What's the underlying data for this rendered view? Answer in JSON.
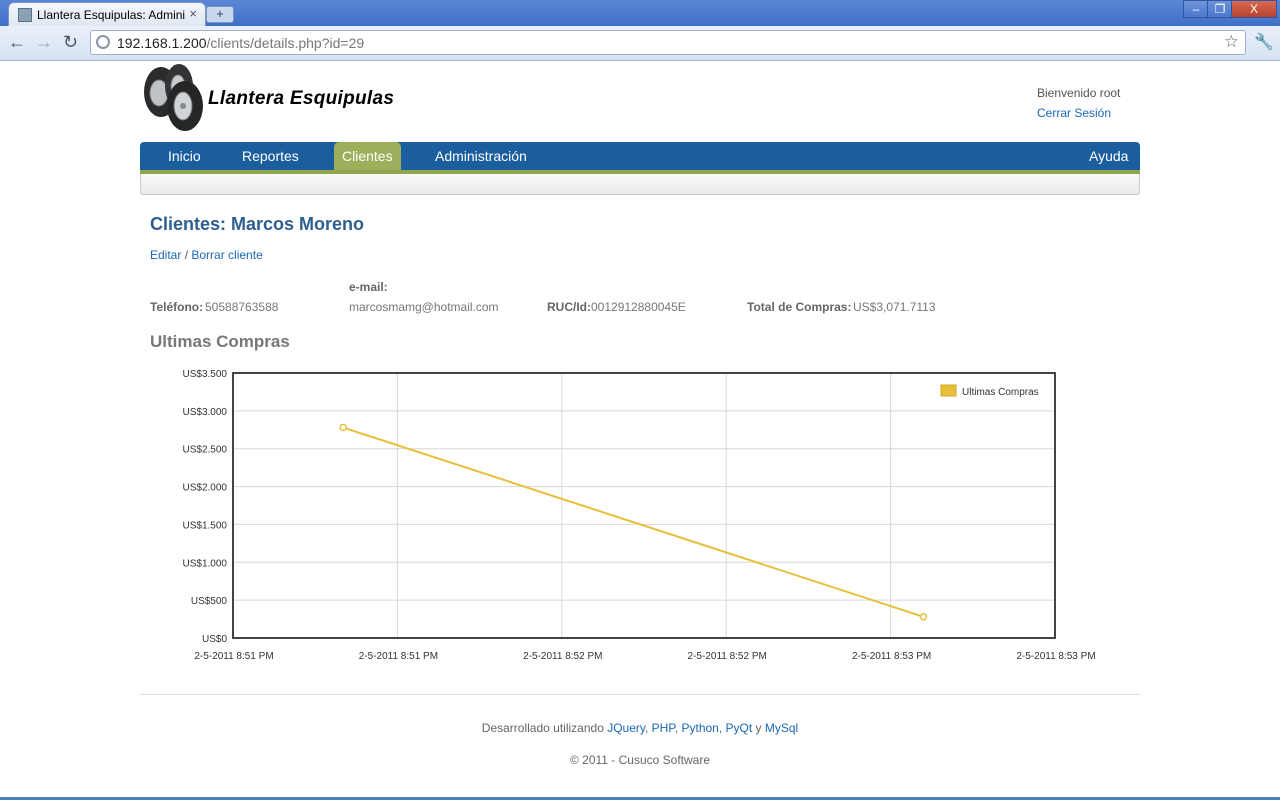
{
  "browser": {
    "tab_title": "Llantera Esquipulas: Admini…",
    "tab_close": "×",
    "new_tab": "+",
    "url_host": "192.168.1.200",
    "url_path": "/clients/details.php?id=29",
    "win_min": "‒",
    "win_max": "❐",
    "win_close": "X"
  },
  "header": {
    "brand": "Llantera Esquipulas",
    "welcome": "Bienvenido root",
    "logout": "Cerrar Sesión"
  },
  "menu": {
    "items": [
      "Inicio",
      "Reportes",
      "Clientes",
      "Administración"
    ],
    "active": "Clientes",
    "help": "Ayuda"
  },
  "client": {
    "title": "Clientes: Marcos Moreno",
    "edit": "Editar",
    "separator": " / ",
    "delete": "Borrar cliente",
    "phone_label": "Teléfono:",
    "phone": "50588763588",
    "email_label": "e-mail:",
    "email": "marcosmamg@hotmail.com",
    "ruc_label": "RUC/Id:",
    "ruc": "0012912880045E",
    "total_label": "Total de Compras:",
    "total": "US$3,071.7113"
  },
  "section_title": "Ultimas Compras",
  "chart_data": {
    "type": "line",
    "legend": "Ultimas Compras",
    "legend_position": "top-right",
    "grid": true,
    "y_ticks": [
      "US$0",
      "US$500",
      "US$1.000",
      "US$1.500",
      "US$2.000",
      "US$2.500",
      "US$3.000",
      "US$3.500"
    ],
    "ylim": [
      0,
      3500
    ],
    "x_ticks": [
      "2-5-2011 8:51 PM",
      "2-5-2011 8:51 PM",
      "2-5-2011 8:52 PM",
      "2-5-2011 8:52 PM",
      "2-5-2011 8:53 PM",
      "2-5-2011 8:53 PM"
    ],
    "xlim": [
      0,
      5
    ],
    "series": [
      {
        "name": "Ultimas Compras",
        "points": [
          {
            "x": 0.67,
            "y": 2780
          },
          {
            "x": 4.2,
            "y": 280
          }
        ]
      }
    ],
    "color": "#e8bf3a"
  },
  "footer": {
    "dev_prefix": "Desarrollado utilizando ",
    "tech": [
      "JQuery",
      "PHP",
      "Python",
      "PyQt",
      "MySql"
    ],
    "copyright": "© 2011 - Cusuco Software"
  }
}
